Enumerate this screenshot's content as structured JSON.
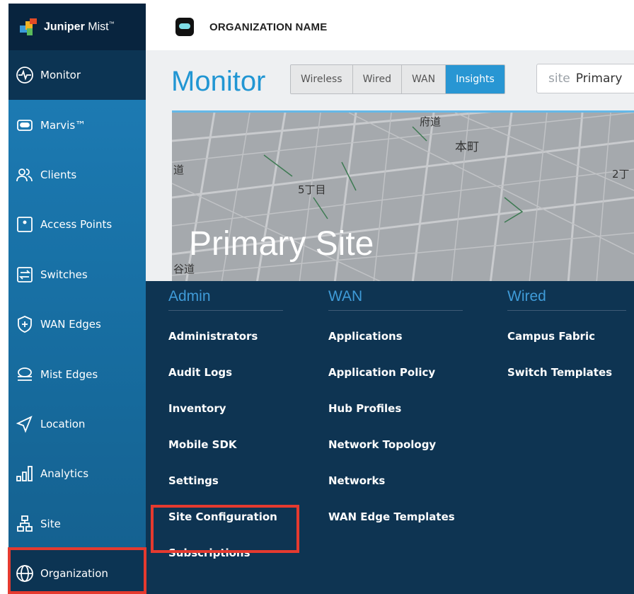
{
  "brand": {
    "name_bold": "Juniper",
    "name_rest": " Mist",
    "tm": "™"
  },
  "org": {
    "name": "ORGANIZATION NAME"
  },
  "sidebar": {
    "items": [
      {
        "label": "Monitor",
        "icon": "pulse-icon"
      },
      {
        "label": "Marvis™",
        "icon": "marvis-icon"
      },
      {
        "label": "Clients",
        "icon": "clients-icon"
      },
      {
        "label": "Access Points",
        "icon": "access-point-icon"
      },
      {
        "label": "Switches",
        "icon": "switch-icon"
      },
      {
        "label": "WAN Edges",
        "icon": "shield-plus-icon"
      },
      {
        "label": "Mist Edges",
        "icon": "mist-edge-icon"
      },
      {
        "label": "Location",
        "icon": "location-arrow-icon"
      },
      {
        "label": "Analytics",
        "icon": "analytics-bars-icon"
      },
      {
        "label": "Site",
        "icon": "site-tree-icon"
      },
      {
        "label": "Organization",
        "icon": "globe-icon"
      }
    ]
  },
  "page": {
    "title": "Monitor",
    "tabs": [
      {
        "label": "Wireless",
        "active": false
      },
      {
        "label": "Wired",
        "active": false
      },
      {
        "label": "WAN",
        "active": false
      },
      {
        "label": "Insights",
        "active": true
      }
    ],
    "site_selector": {
      "key": "site",
      "value": "Primary"
    }
  },
  "map": {
    "site_name": "Primary Site",
    "labels": [
      "本町",
      "5丁目",
      "2丁",
      "道",
      "谷道",
      "府道"
    ]
  },
  "menu": {
    "columns": [
      {
        "heading": "Admin",
        "items": [
          "Administrators",
          "Audit Logs",
          "Inventory",
          "Mobile SDK",
          "Settings",
          "Site Configuration",
          "Subscriptions"
        ]
      },
      {
        "heading": "WAN",
        "items": [
          "Applications",
          "Application Policy",
          "Hub Profiles",
          "Network Topology",
          "Networks",
          "WAN Edge Templates"
        ]
      },
      {
        "heading": "Wired",
        "items": [
          "Campus Fabric",
          "Switch Templates"
        ]
      }
    ]
  },
  "colors": {
    "accent": "#2896d3",
    "highlight": "#e53a2f",
    "menu_bg": "#0e3452"
  }
}
